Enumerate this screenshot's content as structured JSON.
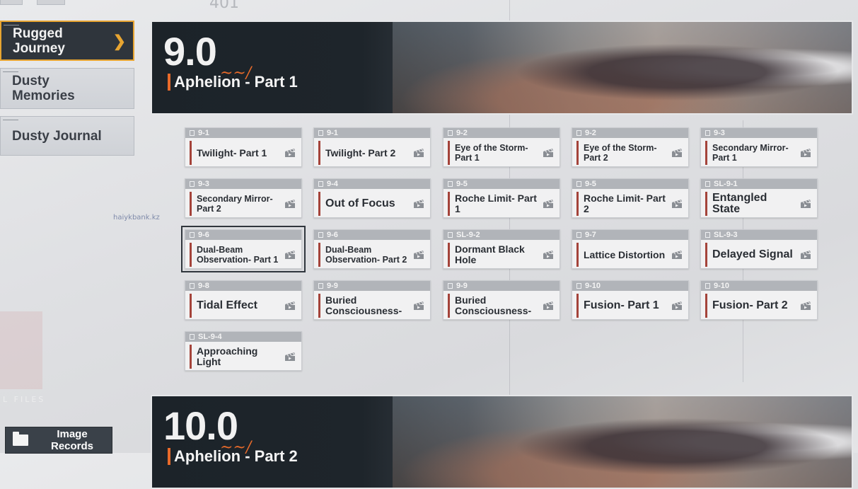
{
  "sidebar": {
    "items": [
      {
        "label": "Rugged Journey",
        "active": true
      },
      {
        "label": "Dusty Memories",
        "active": false
      },
      {
        "label": "Dusty Journal",
        "active": false
      }
    ],
    "image_records_label": "Image Records"
  },
  "background": {
    "file_text": "L FILES",
    "tag_text": "haiykbank.kz",
    "number_text": "401"
  },
  "episodes": [
    {
      "version": "9.0",
      "title": "Aphelion - Part 1"
    },
    {
      "version": "10.0",
      "title": "Aphelion - Part 2"
    }
  ],
  "stages": [
    {
      "code": "9-1",
      "name": "Twilight- Part 1"
    },
    {
      "code": "9-1",
      "name": "Twilight- Part 2"
    },
    {
      "code": "9-2",
      "name": "Eye of the Storm- Part 1"
    },
    {
      "code": "9-2",
      "name": "Eye of the Storm- Part 2"
    },
    {
      "code": "9-3",
      "name": "Secondary Mirror- Part 1"
    },
    {
      "code": "9-3",
      "name": "Secondary Mirror- Part 2"
    },
    {
      "code": "9-4",
      "name": "Out of Focus"
    },
    {
      "code": "9-5",
      "name": "Roche Limit- Part 1"
    },
    {
      "code": "9-5",
      "name": "Roche Limit- Part 2"
    },
    {
      "code": "SL-9-1",
      "name": "Entangled State"
    },
    {
      "code": "9-6",
      "name": "Dual-Beam Observation- Part 1"
    },
    {
      "code": "9-6",
      "name": "Dual-Beam Observation- Part 2"
    },
    {
      "code": "SL-9-2",
      "name": "Dormant Black Hole"
    },
    {
      "code": "9-7",
      "name": "Lattice Distortion"
    },
    {
      "code": "SL-9-3",
      "name": "Delayed Signal"
    },
    {
      "code": "9-8",
      "name": "Tidal Effect"
    },
    {
      "code": "9-9",
      "name": "Buried Consciousness-"
    },
    {
      "code": "9-9",
      "name": "Buried Consciousness-"
    },
    {
      "code": "9-10",
      "name": "Fusion- Part 1"
    },
    {
      "code": "9-10",
      "name": "Fusion- Part 2"
    },
    {
      "code": "SL-9-4",
      "name": "Approaching Light"
    }
  ],
  "colors": {
    "accent": "#e8a531",
    "episode_accent": "#e86a2a",
    "stage_bar": "#a4433a"
  }
}
